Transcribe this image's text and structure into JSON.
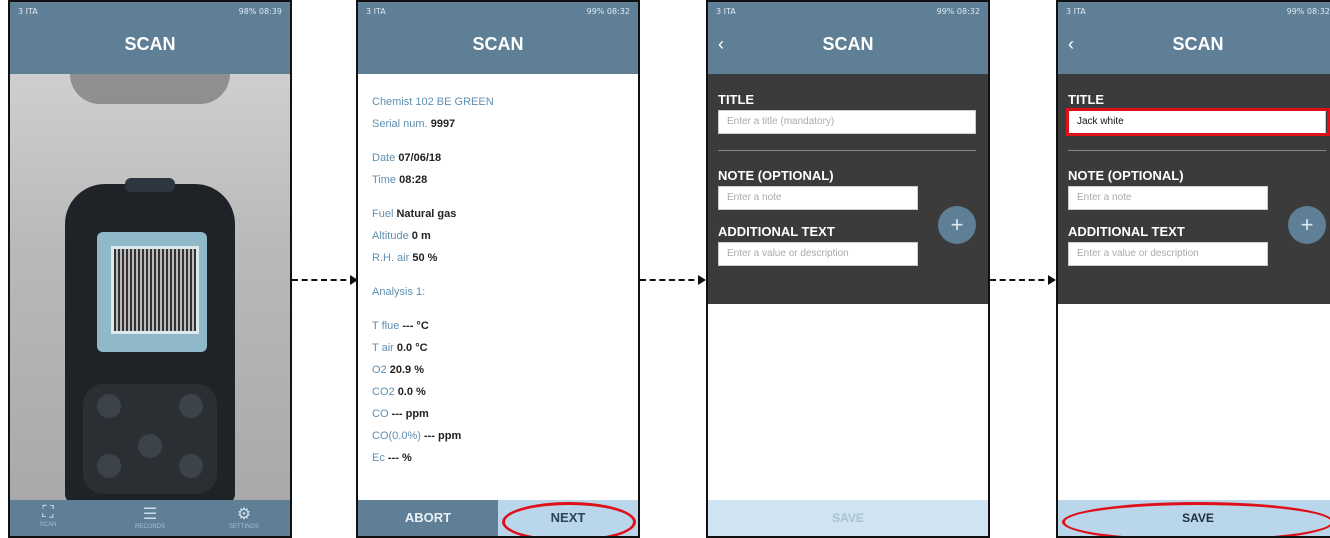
{
  "status": {
    "left": "3 ITA",
    "p1_right": "98% 08:39",
    "p2_right": "99% 08:32",
    "p3_right": "99% 08:32",
    "p4_right": "99% 08:32"
  },
  "screen_title": "SCAN",
  "phone1": {
    "tabs": [
      {
        "label": "SCAN",
        "icon": "scan-frame-icon"
      },
      {
        "label": "RECORDS",
        "icon": "list-icon"
      },
      {
        "label": "SETTINGS",
        "icon": "gear-icon"
      }
    ]
  },
  "phone2": {
    "device": "Chemist 102 BE GREEN",
    "serial_key": "Serial num.",
    "serial_val": "9997",
    "date_key": "Date",
    "date_val": "07/06/18",
    "time_key": "Time",
    "time_val": "08:28",
    "fuel_key": "Fuel",
    "fuel_val": "Natural gas",
    "alt_key": "Altitude",
    "alt_val": "0 m",
    "rh_key": "R.H. air",
    "rh_val": "50 %",
    "analysis": "Analysis 1:",
    "tflue_key": "T flue",
    "tflue_val": "--- °C",
    "tair_key": "T air",
    "tair_val": "0.0 °C",
    "o2_key": "O2",
    "o2_val": "20.9 %",
    "co2_key": "CO2",
    "co2_val": "0.0 %",
    "co_key": "CO",
    "co_val": "--- ppm",
    "co0_key": "CO(0.0%)",
    "co0_val": "--- ppm",
    "ec_key": "Ec",
    "ec_val": "--- %",
    "abort": "ABORT",
    "next": "NEXT"
  },
  "form": {
    "title_label": "TITLE",
    "title_placeholder": "Enter a title (mandatory)",
    "title_value": "Jack white",
    "note_label": "NOTE (OPTIONAL)",
    "note_placeholder": "Enter a note",
    "extra_label": "ADDITIONAL TEXT",
    "extra_placeholder": "Enter a value or description",
    "plus": "+",
    "save": "SAVE"
  },
  "colors": {
    "header": "#5f7f97",
    "form_bg": "#3b3b3b",
    "highlight": "#e0101a"
  }
}
